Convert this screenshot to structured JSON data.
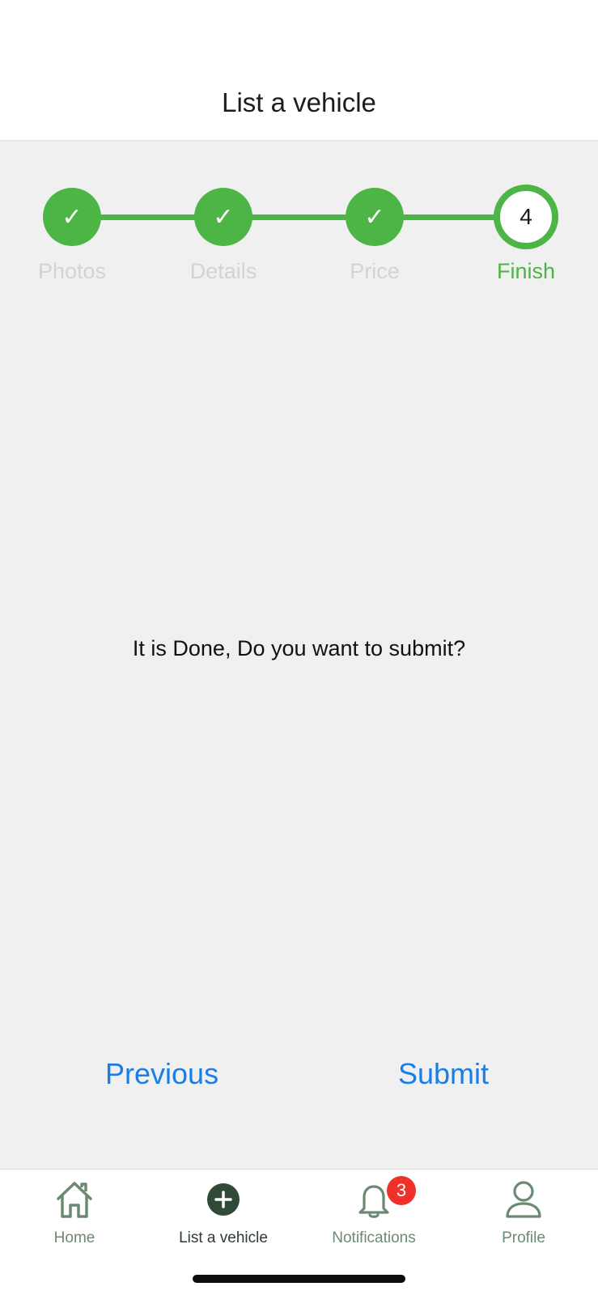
{
  "header": {
    "title": "List a vehicle"
  },
  "stepper": {
    "steps": [
      {
        "label": "Photos",
        "status": "done",
        "icon": "✓"
      },
      {
        "label": "Details",
        "status": "done",
        "icon": "✓"
      },
      {
        "label": "Price",
        "status": "done",
        "icon": "✓"
      },
      {
        "label": "Finish",
        "status": "current",
        "icon": "4"
      }
    ],
    "accent_color": "#4db545"
  },
  "message": "It is Done, Do you want to submit?",
  "actions": {
    "previous_label": "Previous",
    "submit_label": "Submit"
  },
  "tabbar": {
    "tabs": [
      {
        "label": "Home",
        "icon": "home-icon"
      },
      {
        "label": "List a vehicle",
        "icon": "plus-circle-icon",
        "active": true
      },
      {
        "label": "Notifications",
        "icon": "bell-icon",
        "badge": "3"
      },
      {
        "label": "Profile",
        "icon": "user-icon"
      }
    ]
  }
}
